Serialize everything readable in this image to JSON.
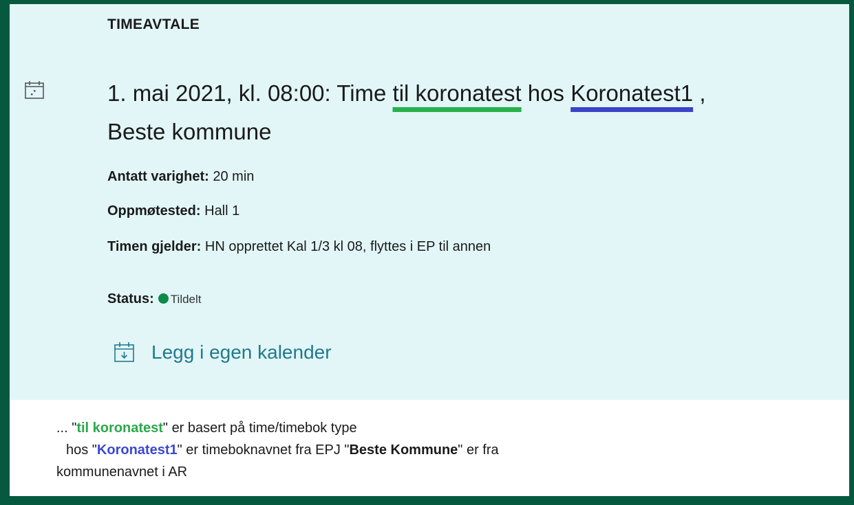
{
  "card": {
    "kicker": "TIMEAVTALE",
    "heading": {
      "pre": "1. mai 2021, kl. 08:00: Time ",
      "type": "til koronatest",
      "mid": " hos ",
      "book": "Koronatest1",
      "tail": " ,",
      "line2": "Beste kommune"
    },
    "duration": {
      "label": "Antatt varighet:",
      "value": " 20 min"
    },
    "location": {
      "label": "Oppmøtested:",
      "value": " Hall 1"
    },
    "concerns": {
      "label": "Timen gjelder:",
      "value": " HN opprettet Kal 1/3 kl 08, flyttes i EP til annen"
    },
    "status": {
      "label": "Status:",
      "value": "Tildelt",
      "color": "#0c8a48"
    },
    "add_calendar": "Legg i egen kalender"
  },
  "note": {
    "p1_pre": "... \"",
    "p1_hl": "til koronatest",
    "p1_post": "\" er basert på time/timebok type",
    "p2_pre": "hos \"",
    "p2_hl": "Koronatest1",
    "p2_mid": "\" er timeboknavnet fra EPJ \"",
    "p2_bold": "Beste Kommune",
    "p2_post": "\" er fra",
    "p3": "kommunenavnet i AR"
  },
  "colors": {
    "frame": "#06593f",
    "card_bg": "#e2f6f7",
    "link": "#21798e",
    "underline_green": "#27b14a",
    "underline_blue": "#3b43c8"
  },
  "icons": [
    "calendar-icon",
    "calendar-download-icon",
    "status-dot-icon"
  ]
}
